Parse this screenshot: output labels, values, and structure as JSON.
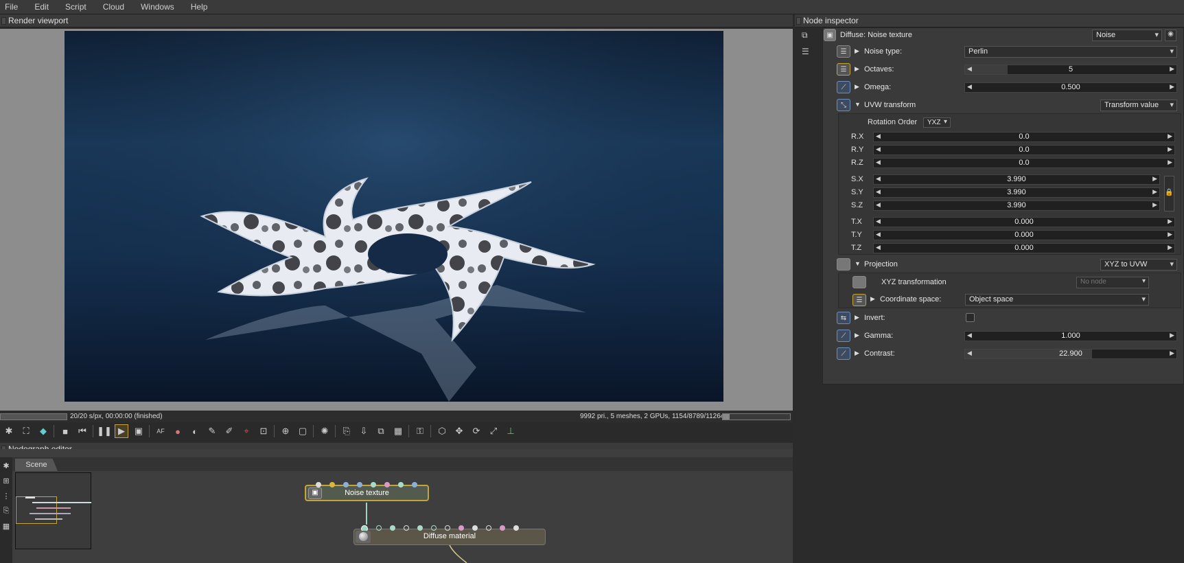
{
  "menu": [
    "File",
    "Edit",
    "Script",
    "Cloud",
    "Windows",
    "Help"
  ],
  "viewport": {
    "title": "Render viewport",
    "status_left": "20/20 s/px, 00:00:00 (finished)",
    "status_right": "9992 pri., 5 meshes, 2 GPUs, 1154/8789/11264 MB",
    "progress": 1.0,
    "memory_fraction": 0.1
  },
  "nodegraph": {
    "title": "Nodegraph editor",
    "tab": "Scene",
    "nodes": {
      "noise": "Noise texture",
      "diffuse": "Diffuse material"
    }
  },
  "inspector": {
    "title": "Node inspector",
    "header": "Diffuse: Noise texture",
    "header_dropdown": "Noise",
    "noise_type": {
      "label": "Noise type:",
      "value": "Perlin"
    },
    "octaves": {
      "label": "Octaves:",
      "value": "5",
      "fill": 0.2
    },
    "omega": {
      "label": "Omega:",
      "value": "0.500",
      "fill": 0.0
    },
    "uvw": {
      "label": "UVW transform",
      "dropdown": "Transform value",
      "rotation_order_label": "Rotation Order",
      "rotation_order": "YXZ",
      "rx": {
        "label": "R.X",
        "value": "0.0"
      },
      "ry": {
        "label": "R.Y",
        "value": "0.0"
      },
      "rz": {
        "label": "R.Z",
        "value": "0.0"
      },
      "sx": {
        "label": "S.X",
        "value": "3.990"
      },
      "sy": {
        "label": "S.Y",
        "value": "3.990"
      },
      "sz": {
        "label": "S.Z",
        "value": "3.990"
      },
      "tx": {
        "label": "T.X",
        "value": "0.000"
      },
      "ty": {
        "label": "T.Y",
        "value": "0.000"
      },
      "tz": {
        "label": "T.Z",
        "value": "0.000"
      }
    },
    "projection": {
      "label": "Projection",
      "dropdown": "XYZ to UVW",
      "xyz_label": "XYZ transformation",
      "xyz_value": "No node",
      "coord_label": "Coordinate space:",
      "coord_value": "Object space"
    },
    "invert": {
      "label": "Invert:"
    },
    "gamma": {
      "label": "Gamma:",
      "value": "1.000",
      "fill": 0.0
    },
    "contrast": {
      "label": "Contrast:",
      "value": "22.900",
      "fill": 0.6
    }
  }
}
